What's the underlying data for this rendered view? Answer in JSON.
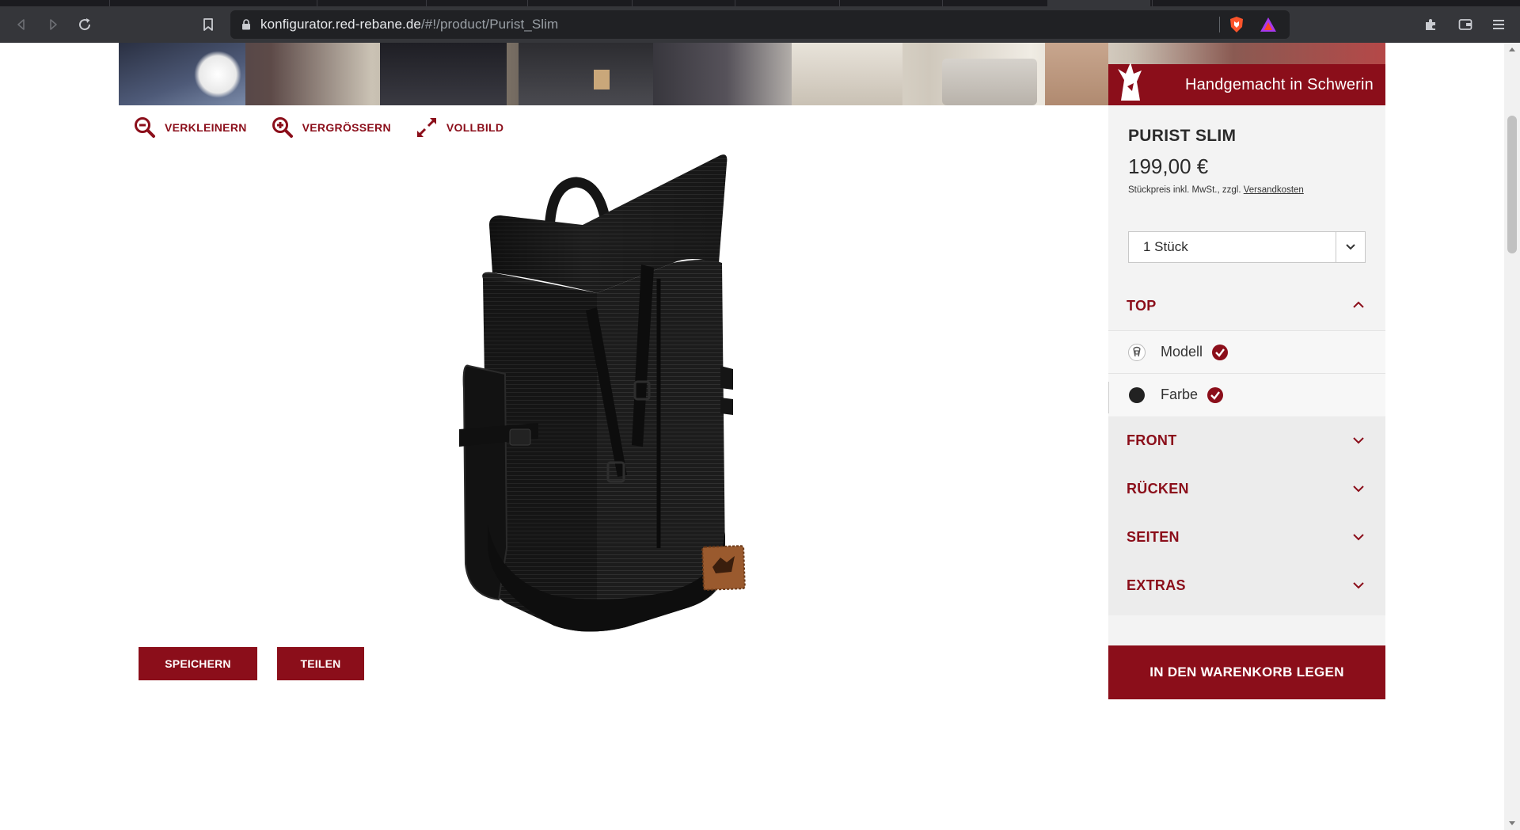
{
  "browser": {
    "url_host": "konfigurator.red-rebane.de",
    "url_path": "/#!/product/Purist_Slim",
    "icons": [
      "back-icon",
      "forward-icon",
      "reload-icon",
      "bookmark-icon",
      "lock-icon",
      "brave-shield-icon",
      "brave-rewards-icon",
      "extensions-icon",
      "wallet-icon",
      "menu-icon"
    ]
  },
  "banner": {
    "tagline": "Handgemacht in Schwerin"
  },
  "viewer": {
    "zoom_out_label": "VERKLEINERN",
    "zoom_in_label": "VERGRÖSSERN",
    "fullscreen_label": "VOLLBILD"
  },
  "actions": {
    "save_label": "SPEICHERN",
    "share_label": "TEILEN"
  },
  "product": {
    "name": "PURIST SLIM",
    "price": "199,00 €",
    "price_note": "Stückpreis inkl. MwSt., zzgl.",
    "shipping_link": "Versandkosten",
    "quantity": "1 Stück"
  },
  "config": {
    "sections": [
      {
        "title": "TOP",
        "expanded": true,
        "items": [
          {
            "label": "Modell",
            "done": true
          },
          {
            "label": "Farbe",
            "done": true,
            "swatch": "#222222"
          }
        ]
      },
      {
        "title": "FRONT",
        "expanded": false
      },
      {
        "title": "RÜCKEN",
        "expanded": false
      },
      {
        "title": "SEITEN",
        "expanded": false
      },
      {
        "title": "EXTRAS",
        "expanded": false
      }
    ]
  },
  "cart": {
    "label": "IN DEN WARENKORB LEGEN"
  },
  "colors": {
    "brand_red": "#8b0e1a",
    "panel_bg": "#f3f3f3",
    "chrome_dark": "#35363a"
  }
}
